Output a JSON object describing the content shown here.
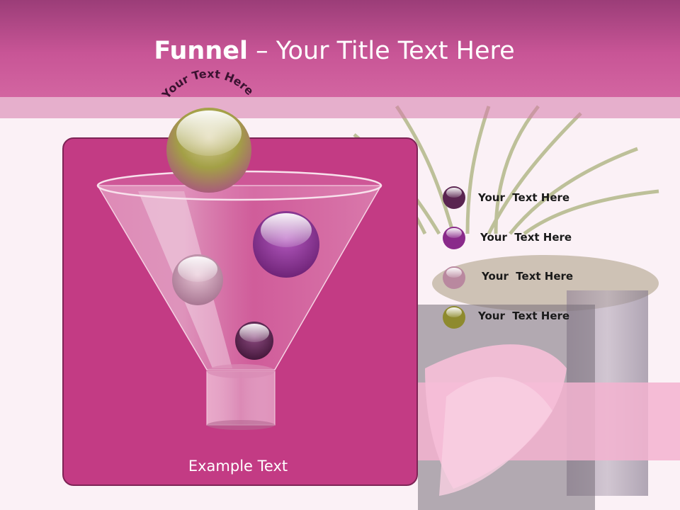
{
  "slide": {
    "title_bold": "Funnel",
    "title_rest": " – Your Title Text Here",
    "arc_text": "Your Text Here",
    "example_text": "Example Text",
    "legend": [
      {
        "label": "Your  Text Here",
        "color": "#5a2450"
      },
      {
        "label": "Your  Text Here",
        "color": "#8a2a8a"
      },
      {
        "label": "Your  Text Here",
        "color": "#b9889f"
      },
      {
        "label": "Your  Text Here",
        "color": "#8e8a2e"
      }
    ]
  },
  "colors": {
    "header": "#c85596",
    "panel": "#c33b84",
    "panel_border": "#7e2456"
  }
}
